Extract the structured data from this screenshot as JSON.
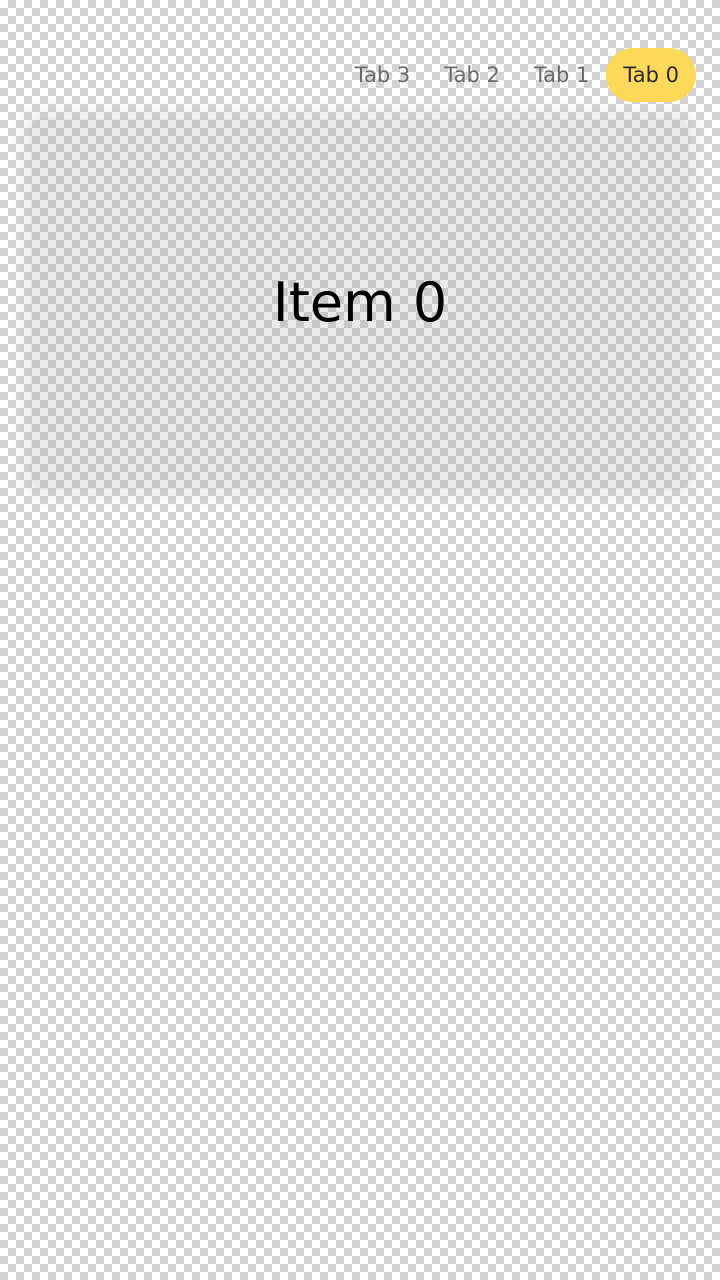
{
  "tabs": [
    {
      "label": "Tab 3",
      "active": false
    },
    {
      "label": "Tab 2",
      "active": false
    },
    {
      "label": "Tab 1",
      "active": false
    },
    {
      "label": "Tab 0",
      "active": true
    }
  ],
  "card": {
    "title": "Item 0"
  },
  "colors": {
    "active_tab_bg": "#ffd95a",
    "inactive_tab_text": "#6b6b6b",
    "active_tab_text": "#2a2a2a"
  }
}
